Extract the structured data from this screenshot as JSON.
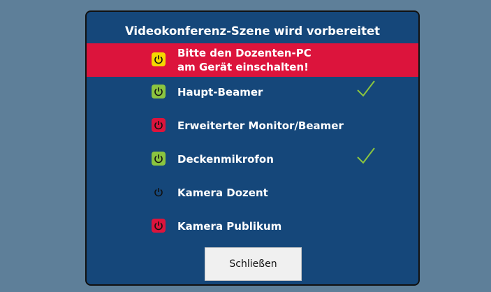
{
  "dialog": {
    "title": "Videokonferenz-Szene wird vorbereitet",
    "alert": {
      "line1": "Bitte den Dozenten-PC",
      "line2": "am Gerät einschalten!",
      "icon": "power-icon",
      "status_color": "#f5d800"
    },
    "devices": [
      {
        "label": "Haupt-Beamer",
        "status_color": "#8bc53f",
        "check": true
      },
      {
        "label": "Erweiterter Monitor/Beamer",
        "status_color": "#dc143c",
        "check": false
      },
      {
        "label": "Deckenmikrofon",
        "status_color": "#8bc53f",
        "check": true
      },
      {
        "label": "Kamera Dozent",
        "status_color": "none",
        "check": false
      },
      {
        "label": "Kamera Publikum",
        "status_color": "#dc143c",
        "check": false
      }
    ],
    "close_label": "Schließen"
  },
  "colors": {
    "background": "#5e7f99",
    "dialog": "#15477a",
    "alert": "#dc143c",
    "check": "#8bc53f"
  }
}
